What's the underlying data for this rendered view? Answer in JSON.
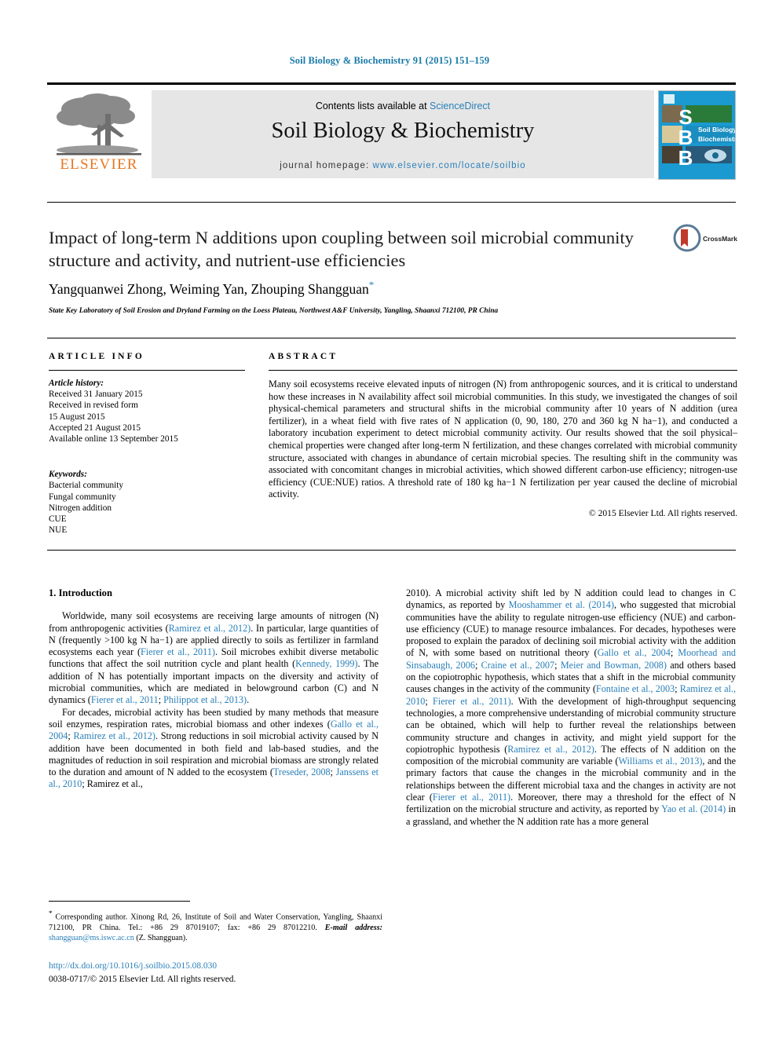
{
  "running_head": "Soil Biology & Biochemistry 91 (2015) 151–159",
  "masthead": {
    "contents_prefix": "Contents lists available at ",
    "contents_link": "ScienceDirect",
    "journal_title": "Soil Biology & Biochemistry",
    "homepage_label": "journal homepage: ",
    "homepage_url": "www.elsevier.com/locate/soilbio",
    "publisher_logo_text": "ELSEVIER",
    "publisher_logo_icon": "elsevier-tree-icon",
    "cover_icon": "journal-cover-thumbnail",
    "cover_letters": [
      "S",
      "B",
      "B"
    ],
    "cover_title_line1": "Soil Biology &",
    "cover_title_line2": "Biochemistry"
  },
  "article": {
    "title": "Impact of long-term N additions upon coupling between soil microbial community structure and activity, and nutrient-use efficiencies",
    "authors": "Yangquanwei Zhong, Weiming Yan, Zhouping Shangguan",
    "corresponding_marker": "*",
    "affiliation": "State Key Laboratory of Soil Erosion and Dryland Farming on the Loess Plateau, Northwest A&F University, Yangling, Shaanxi 712100, PR China",
    "crossmark_label": "CrossMark",
    "crossmark_icon": "crossmark-badge-icon"
  },
  "article_info": {
    "heading": "ARTICLE INFO",
    "history_label": "Article history:",
    "history_lines": [
      "Received 31 January 2015",
      "Received in revised form",
      "15 August 2015",
      "Accepted 21 August 2015",
      "Available online 13 September 2015"
    ],
    "keywords_label": "Keywords:",
    "keywords": [
      "Bacterial community",
      "Fungal community",
      "Nitrogen addition",
      "CUE",
      "NUE"
    ]
  },
  "abstract": {
    "heading": "ABSTRACT",
    "text": "Many soil ecosystems receive elevated inputs of nitrogen (N) from anthropogenic sources, and it is critical to understand how these increases in N availability affect soil microbial communities. In this study, we investigated the changes of soil physical-chemical parameters and structural shifts in the microbial community after 10 years of N addition (urea fertilizer), in a wheat field with five rates of N application (0, 90, 180, 270 and 360 kg N ha−1), and conducted a laboratory incubation experiment to detect microbial community activity. Our results showed that the soil physical–chemical properties were changed after long-term N fertilization, and these changes correlated with microbial community structure, associated with changes in abundance of certain microbial species. The resulting shift in the community was associated with concomitant changes in microbial activities, which showed different carbon-use efficiency; nitrogen-use efficiency (CUE:NUE) ratios. A threshold rate of 180 kg ha−1 N fertilization per year caused the decline of microbial activity.",
    "copyright": "© 2015 Elsevier Ltd. All rights reserved."
  },
  "body": {
    "section_heading": "1. Introduction",
    "left_paragraphs": [
      "Worldwide, many soil ecosystems are receiving large amounts of nitrogen (N) from anthropogenic activities (Ramirez et al., 2012). In particular, large quantities of N (frequently >100 kg N ha−1) are applied directly to soils as fertilizer in farmland ecosystems each year (Fierer et al., 2011). Soil microbes exhibit diverse metabolic functions that affect the soil nutrition cycle and plant health (Kennedy, 1999). The addition of N has potentially important impacts on the diversity and activity of microbial communities, which are mediated in belowground carbon (C) and N dynamics (Fierer et al., 2011; Philippot et al., 2013).",
      "For decades, microbial activity has been studied by many methods that measure soil enzymes, respiration rates, microbial biomass and other indexes (Gallo et al., 2004; Ramirez et al., 2012). Strong reductions in soil microbial activity caused by N addition have been documented in both field and lab-based studies, and the magnitudes of reduction in soil respiration and microbial biomass are strongly related to the duration and amount of N added to the ecosystem (Treseder, 2008; Janssens et al., 2010; Ramirez et al.,"
    ],
    "right_paragraphs": [
      "2010). A microbial activity shift led by N addition could lead to changes in C dynamics, as reported by Mooshammer et al. (2014), who suggested that microbial communities have the ability to regulate nitrogen-use efficiency (NUE) and carbon-use efficiency (CUE) to manage resource imbalances. For decades, hypotheses were proposed to explain the paradox of declining soil microbial activity with the addition of N, with some based on nutritional theory (Gallo et al., 2004; Moorhead and Sinsabaugh, 2006; Craine et al., 2007; Meier and Bowman, 2008) and others based on the copiotrophic hypothesis, which states that a shift in the microbial community causes changes in the activity of the community (Fontaine et al., 2003; Ramirez et al., 2010; Fierer et al., 2011). With the development of high-throughput sequencing technologies, a more comprehensive understanding of microbial community structure can be obtained, which will help to further reveal the relationships between community structure and changes in activity, and might yield support for the copiotrophic hypothesis (Ramirez et al., 2012). The effects of N addition on the composition of the microbial community are variable (Williams et al., 2013), and the primary factors that cause the changes in the microbial community and in the relationships between the different microbial taxa and the changes in activity are not clear (Fierer et al., 2011). Moreover, there may a threshold for the effect of N fertilization on the microbial structure and activity, as reported by Yao et al. (2014) in a grassland, and whether the N addition rate has a more general"
    ]
  },
  "footnote": {
    "marker": "*",
    "text": "Corresponding author. Xinong Rd, 26, Institute of Soil and Water Conservation, Yangling, Shaanxi 712100, PR China. Tel.: +86 29 87019107; fax: +86 29 87012210.",
    "email_label": "E-mail address:",
    "email": "shangguan@ms.iswc.ac.cn",
    "email_suffix": "(Z. Shangguan)."
  },
  "footer": {
    "doi": "http://dx.doi.org/10.1016/j.soilbio.2015.08.030",
    "issn_copyright": "0038-0717/© 2015 Elsevier Ltd. All rights reserved."
  },
  "colors": {
    "link_blue": "#2a7fb8",
    "header_blue": "#1a7aa8",
    "elsevier_orange": "#E87722",
    "banner_grey": "#e6e6e6",
    "cover_blue": "#1a9ad0"
  }
}
